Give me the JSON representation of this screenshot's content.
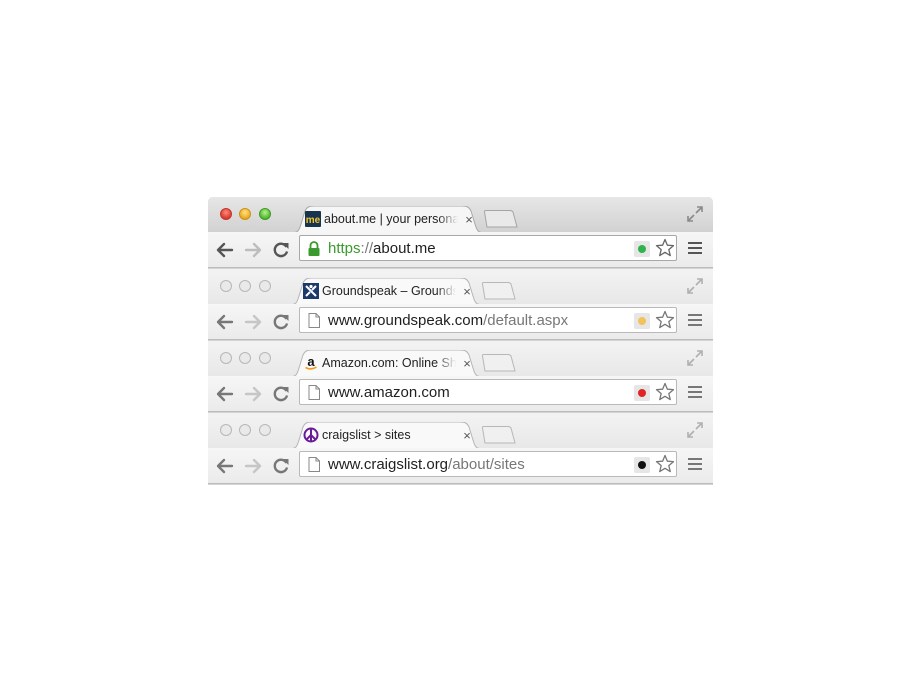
{
  "windows": [
    {
      "state": "active",
      "tab": {
        "title": "about.me | your personal h",
        "favicon": "aboutme-icon",
        "favicon_text": "me",
        "close": "×"
      },
      "omnibox": {
        "security": "lock-icon",
        "scheme": "https",
        "sep": "://",
        "host": "about.me",
        "path": ""
      },
      "extension_color": "#2fb34a"
    },
    {
      "state": "inactive",
      "tab": {
        "title": "Groundspeak – Groundspeak",
        "favicon": "groundspeak-icon",
        "favicon_text": "",
        "close": "×"
      },
      "omnibox": {
        "security": "page-icon",
        "scheme": "",
        "sep": "",
        "host": "www.groundspeak.com",
        "path": "/default.aspx"
      },
      "extension_color": "#f2c25b"
    },
    {
      "state": "inactive",
      "tab": {
        "title": "Amazon.com: Online Shopp",
        "favicon": "amazon-icon",
        "favicon_text": "a",
        "close": "×"
      },
      "omnibox": {
        "security": "page-icon",
        "scheme": "",
        "sep": "",
        "host": "www.amazon.com",
        "path": ""
      },
      "extension_color": "#e02424"
    },
    {
      "state": "inactive",
      "tab": {
        "title": "craigslist > sites",
        "favicon": "peace-icon",
        "favicon_text": "",
        "close": "×"
      },
      "omnibox": {
        "security": "page-icon",
        "scheme": "",
        "sep": "",
        "host": "www.craigslist.org",
        "path": "/about/sites"
      },
      "extension_color": "#111111"
    }
  ]
}
